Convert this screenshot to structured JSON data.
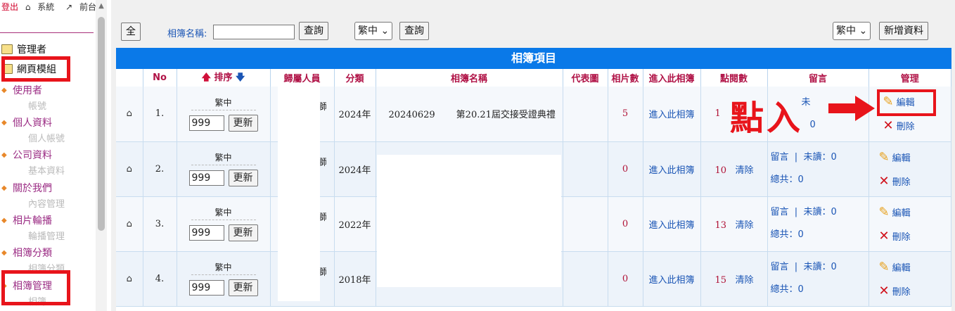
{
  "topnav": {
    "logout": "登出",
    "system": "系統",
    "front": "前台"
  },
  "sidebar": {
    "folders": [
      "管理者",
      "網頁模組"
    ],
    "items": [
      {
        "label": "使用者",
        "sub": "帳號"
      },
      {
        "label": "個人資料",
        "sub": "個人帳號"
      },
      {
        "label": "公司資料",
        "sub": "基本資料"
      },
      {
        "label": "關於我們",
        "sub": "內容管理"
      },
      {
        "label": "相片輪播",
        "sub": "輪播管理"
      },
      {
        "label": "相簿分類",
        "sub": "相簿分類"
      },
      {
        "label": "相簿管理",
        "sub": "相簿"
      }
    ]
  },
  "toolbar": {
    "all_label": "全",
    "search_label": "相簿名稱:",
    "search_value": "",
    "query_label": "查詢",
    "lang_value": "繁中",
    "query2_label": "查詢",
    "lang_value_right": "繁中",
    "add_label": "新增資料"
  },
  "table": {
    "title": "相簿項目",
    "headers": [
      "",
      "No",
      "排序",
      "歸屬人員",
      "分類",
      "相簿名稱",
      "代表圖",
      "相片數",
      "進入此相簿",
      "點閱數",
      "留言",
      "管理"
    ],
    "rows": [
      {
        "no": "1.",
        "lang": "繁中",
        "order": "999",
        "update": "更新",
        "owner": "獅",
        "category": "2024年",
        "name_prefix": "20240629",
        "name": "第20.21屆交接受證典禮",
        "photos": "5",
        "enter": "進入此相簿",
        "views": "1",
        "clear": "",
        "msg": "未",
        "msg_unread": "",
        "msg_total": "0",
        "edit": "編輯",
        "delete": "刪除"
      },
      {
        "no": "2.",
        "lang": "繁中",
        "order": "999",
        "update": "更新",
        "owner": "獅",
        "category": "2024年",
        "name_prefix": "",
        "name": "",
        "photos": "0",
        "enter": "進入此相簿",
        "views": "10",
        "clear": "清除",
        "msg": "留言",
        "msg_unread": "未讀：0",
        "msg_total": "總共：0",
        "edit": "編輯",
        "delete": "刪除"
      },
      {
        "no": "3.",
        "lang": "繁中",
        "order": "999",
        "update": "更新",
        "owner": "獅",
        "category": "2022年",
        "name_prefix": "",
        "name": "",
        "photos": "0",
        "enter": "進入此相簿",
        "views": "13",
        "clear": "清除",
        "msg": "留言",
        "msg_unread": "未讀：0",
        "msg_total": "總共：0",
        "edit": "編輯",
        "delete": "刪除"
      },
      {
        "no": "4.",
        "lang": "繁中",
        "order": "999",
        "update": "更新",
        "owner": "獅",
        "category": "2018年",
        "name_prefix": "",
        "name": "",
        "photos": "0",
        "enter": "進入此相簿",
        "views": "15",
        "clear": "清除",
        "msg": "留言",
        "msg_unread": "未讀：0",
        "msg_total": "總共：0",
        "edit": "編輯",
        "delete": "刪除"
      }
    ]
  },
  "annotation": {
    "text": "點入"
  },
  "colors": {
    "accent": "#0a79e8",
    "highlight": "#e8141b",
    "header_text": "#b01246",
    "link": "#1a55b5"
  }
}
